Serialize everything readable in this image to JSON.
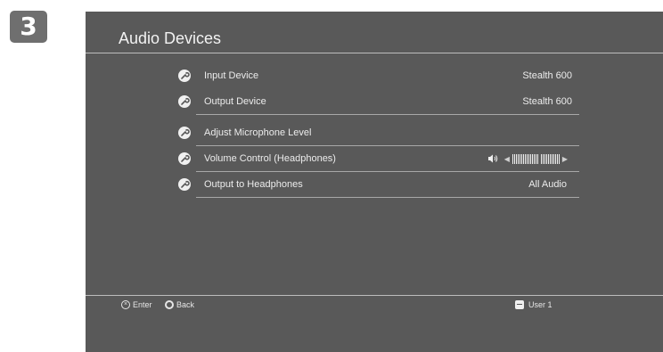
{
  "step_number": "3",
  "screen": {
    "title": "Audio Devices",
    "menu": [
      {
        "label": "Input Device",
        "value": "Stealth 600",
        "icon": "wrench-icon"
      },
      {
        "label": "Output Device",
        "value": "Stealth 600",
        "icon": "wrench-icon"
      },
      {
        "label": "Adjust Microphone Level",
        "value": "",
        "icon": "wrench-icon"
      },
      {
        "label": "Volume Control (Headphones)",
        "value": "",
        "icon": "wrench-icon",
        "volume_level": 1.0
      },
      {
        "label": "Output to Headphones",
        "value": "All Audio",
        "icon": "wrench-icon"
      }
    ]
  },
  "footer": {
    "enter_glyph": "×",
    "enter_label": "Enter",
    "back_label": "Back",
    "user_label": "User 1"
  },
  "colors": {
    "screen_bg": "#595959",
    "text": "#e6e6e6",
    "badge_bg": "#6f6f6f"
  }
}
